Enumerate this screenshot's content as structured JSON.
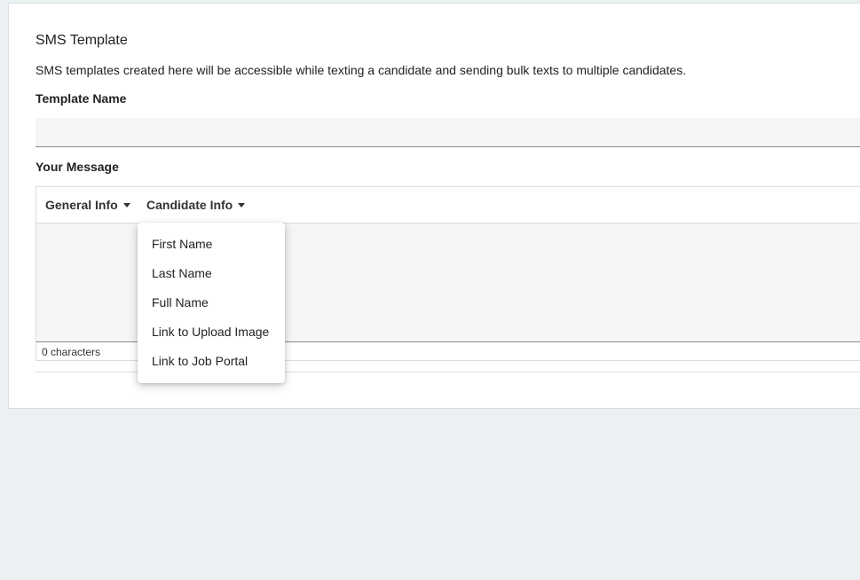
{
  "card": {
    "title": "SMS Template",
    "description": "SMS templates created here will be accessible while texting a candidate and sending bulk texts to multiple candidates."
  },
  "template_name": {
    "label": "Template Name",
    "value": "",
    "placeholder": ""
  },
  "message": {
    "label": "Your Message",
    "toolbar": {
      "general_info": "General Info",
      "candidate_info": "Candidate Info"
    },
    "counter": "0 characters"
  },
  "candidate_dropdown": {
    "items": [
      "First Name",
      "Last Name",
      "Full Name",
      "Link to Upload Image",
      "Link to Job Portal"
    ]
  },
  "icons": {
    "general_caret": "chevron-down-icon",
    "candidate_caret": "chevron-down-icon"
  },
  "colors": {
    "page_background": "#ebf0f3",
    "card_background": "#ffffff",
    "input_background": "#f5f5f5"
  }
}
